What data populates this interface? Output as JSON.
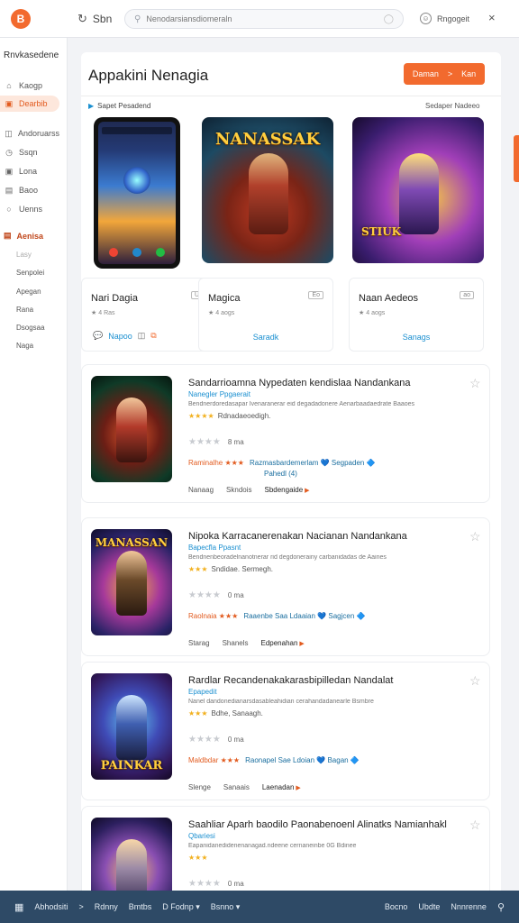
{
  "topbar": {
    "logo": "B",
    "back_label": "Sbn",
    "search_placeholder": "Nenodarsiansdiomeraln",
    "account_label": "Rngogeit",
    "close": "×"
  },
  "sidebar": {
    "heading": "Rnvkasedene",
    "items": [
      {
        "label": "Kaogp",
        "icon": "home-icon"
      },
      {
        "label": "Dearbib",
        "icon": "bag-icon",
        "active": true
      },
      {
        "label": "Andoruarss",
        "icon": "apps-icon"
      },
      {
        "label": "Ssqn",
        "icon": "clock-icon"
      },
      {
        "label": "Lona",
        "icon": "grid-icon"
      },
      {
        "label": "Baoo",
        "icon": "book-icon"
      },
      {
        "label": "Uenns",
        "icon": "circle-icon"
      }
    ],
    "section": "Aenisa",
    "sub_items": [
      {
        "label": "Lasy",
        "muted": true
      },
      {
        "label": "Senpolei"
      },
      {
        "label": "Apegan"
      },
      {
        "label": "Rana"
      },
      {
        "label": "Dsogsaa"
      },
      {
        "label": "Naga"
      }
    ]
  },
  "main": {
    "title": "Appakini Nenagia",
    "cta": {
      "label": "Daman",
      "arrow": ">",
      "icon": "Kan"
    },
    "row_label": "Sapet Pesadend",
    "row_right": "Sedaper Nadeeo",
    "featured": [
      {
        "name": "Nari Dagia",
        "badge": "Uo",
        "sub": "4 Ras",
        "action": "Napoo",
        "has_icons": true,
        "art_text": ""
      },
      {
        "name": "Magica",
        "badge": "Eo",
        "sub": "4 aogs",
        "action": "Saradk",
        "art_text": "NANASSAK"
      },
      {
        "name": "Naan Aedeos",
        "badge": "ao",
        "sub": "4 aogs",
        "action": "Sanags",
        "art_text": "STIUK"
      }
    ],
    "list": [
      {
        "title": "Sandarrioamna Nypedaten kendislaa Nandankana",
        "developer": "Nanegler Ppgaerait",
        "description": "Bendnerdoredasapar Ivenaranerar eid degadadonere Aenarbaadaedrate Baaoes",
        "stars": "★★★★",
        "tag": "Rdnadaeoedigh.",
        "rating_stars": "★★★★",
        "rating_count": "8 ma",
        "promo_label": "Raminalhe ★★★",
        "promo_note": "Razmasbardemerlam 💙 Segpaden 🔷",
        "promo_extra": "Pahedl (4)",
        "actions": [
          "Nanaag",
          "Skndois",
          "Sbdengaide"
        ],
        "art_text": ""
      },
      {
        "title": "Nipoka Karracanerenakan Nacianan Nandankana",
        "developer": "Bapecfla Ppasnt",
        "description": "Bendnenbeoradelnanotnerar rid degdonerainy carbanidadas de Aaines",
        "stars": "★★★",
        "tag": "Sndidae. Sermegh.",
        "rating_stars": "★★★★",
        "rating_count": "0 ma",
        "promo_label": "Raolnaia ★★★",
        "promo_note": "Raaenbe Saa Ldaaian 💙 Sagjcen 🔷",
        "promo_extra": "",
        "actions": [
          "Starag",
          "Shanels",
          "Edpenahan"
        ],
        "art_text": "MANASSAN"
      },
      {
        "title": "Rardlar Recandenakakarasbipilledan Nandalat",
        "developer": "Epapedit",
        "description": "Nanel dandonedianarsdasableahidian cerahandadanearle Bsmbre",
        "stars": "★★★",
        "tag": "Bdhe, Sanaagh.",
        "rating_stars": "★★★★",
        "rating_count": "0 ma",
        "promo_label": "Maldbdar ★★★",
        "promo_note": "Raonapel Sae Ldoian 💙 Bagan 🔷",
        "promo_extra": "",
        "actions": [
          "Slenge",
          "Sanaais",
          "Laenadan"
        ],
        "art_text": "PAINKAR"
      },
      {
        "title": "Saahliar Aparh baodilo Paonabenoenl Alinatks Namianhakl",
        "developer": "Qbariesi",
        "description": "Eapanidanedidenenanagad.ndeene cernaneinbe 0G Bdinee",
        "stars": "★★★",
        "tag": "",
        "rating_stars": "★★★★",
        "rating_count": "0 ma",
        "promo_label": "",
        "promo_note": "",
        "promo_extra": "",
        "actions": [],
        "art_text": ""
      }
    ]
  },
  "bottombar": {
    "left": [
      "Abhodsiti",
      ">",
      "Rdnny",
      "Bmtbs",
      "D Fodnp ▾",
      "Bsnno ▾"
    ],
    "right": [
      "Bocno",
      "Ubdte",
      "Nnnrenne"
    ]
  },
  "colors": {
    "accent": "#f26a2e",
    "link": "#1a8fd0",
    "bottom": "#2e4a66"
  }
}
